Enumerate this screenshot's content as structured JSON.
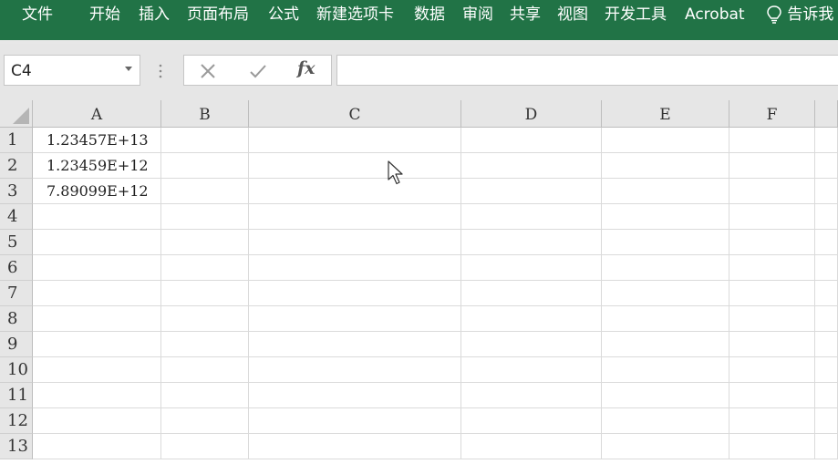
{
  "ribbon": {
    "tabs": [
      "文件",
      "开始",
      "插入",
      "页面布局",
      "公式",
      "新建选项卡",
      "数据",
      "审阅",
      "共享",
      "视图",
      "开发工具",
      "Acrobat"
    ],
    "tell_me": "告诉我",
    "background_color": "#217346"
  },
  "formula_bar": {
    "name_box": "C4",
    "cancel_icon": "cancel-icon",
    "enter_icon": "check-icon",
    "fx_label": "fx",
    "formula_value": ""
  },
  "sheet": {
    "columns": [
      "A",
      "B",
      "C",
      "D",
      "E",
      "F"
    ],
    "rows": [
      "1",
      "2",
      "3",
      "4",
      "5",
      "6",
      "7",
      "8",
      "9",
      "10",
      "11",
      "12",
      "13"
    ],
    "cells": {
      "A1": "1.23457E+13",
      "A2": "1.23459E+12",
      "A3": "7.89099E+12"
    }
  }
}
